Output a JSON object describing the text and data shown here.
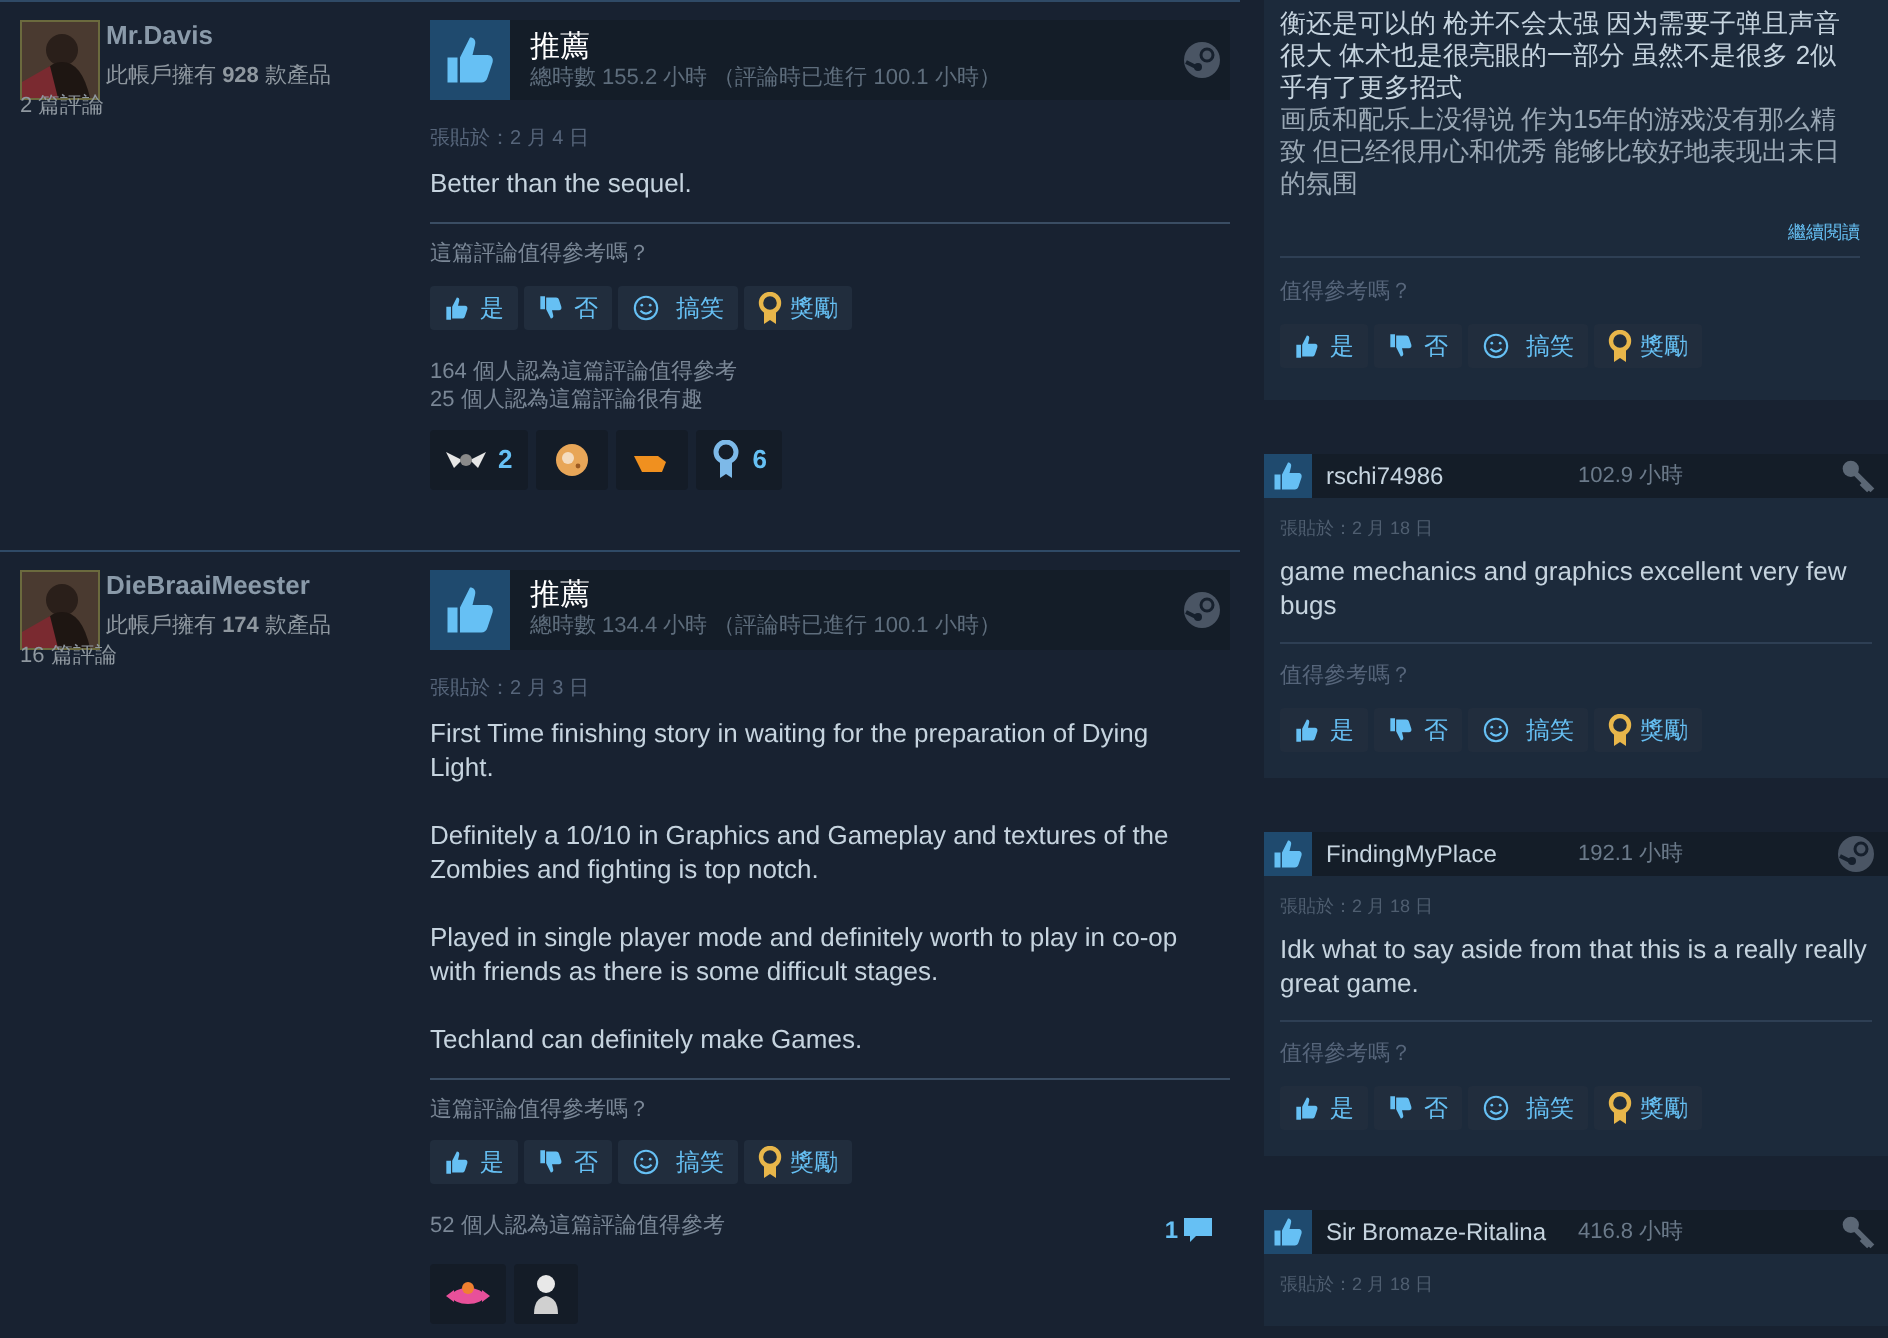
{
  "main_reviews": [
    {
      "author": {
        "name": "Mr.Davis",
        "products": "此帳戶擁有 **928** 款產品",
        "reviews": "2 篇評論"
      },
      "verdict": "推薦",
      "hours": "總時數 155.2 小時 （評論時已進行 100.1 小時）",
      "source": {
        "kind": "steam"
      },
      "posted": "張貼於：2 月 4 日",
      "body": "Better than the sequel.",
      "question": "這篇評論值得參考嗎？",
      "votes": [
        {
          "label": "是",
          "kind": "yes"
        },
        {
          "label": "否",
          "kind": "no"
        },
        {
          "label": "搞笑",
          "kind": "funny"
        },
        {
          "label": "獎勵",
          "kind": "award"
        }
      ],
      "stats": [
        "164 個人認為這篇評論值得參考",
        "25 個人認為這篇評論很有趣"
      ],
      "awards": [
        {
          "kind": "wings",
          "count": "2"
        },
        {
          "kind": "cookie"
        },
        {
          "kind": "hand"
        },
        {
          "kind": "medal",
          "count": "6"
        }
      ]
    },
    {
      "author": {
        "name": "DieBraaiMeester",
        "products": "此帳戶擁有 **174** 款產品",
        "reviews": "16 篇評論"
      },
      "verdict": "推薦",
      "hours": "總時數 134.4 小時 （評論時已進行 100.1 小時）",
      "source": {
        "kind": "steam"
      },
      "posted": "張貼於：2 月 3 日",
      "body": "First Time finishing story in waiting for the preparation of Dying Light.\n\nDefinitely a 10/10 in Graphics and Gameplay and textures of the Zombies and fighting is top notch.\n\nPlayed in single player mode and definitely worth to play in co-op with friends as there is some difficult stages.\n\nTechland can definitely make Games.",
      "question": "這篇評論值得參考嗎？",
      "votes": [
        {
          "label": "是",
          "kind": "yes"
        },
        {
          "label": "否",
          "kind": "no"
        },
        {
          "label": "搞笑",
          "kind": "funny"
        },
        {
          "label": "獎勵",
          "kind": "award"
        }
      ],
      "stats": [
        "52 個人認為這篇評論值得參考"
      ],
      "comments": "1",
      "awards": [
        {
          "kind": "critter"
        },
        {
          "kind": "bust"
        }
      ]
    }
  ],
  "side_reviews": [
    {
      "kind": "excerpt",
      "paragraphs": [
        "衡还是可以的 枪并不会太强 因为需要子弹且声音很大 体术也是很亮眼的一部分 虽然不是很多 2似乎有了更多招式",
        "画质和配乐上没得说 作为15年的游戏没有那么精致 但已经很用心和优秀 能够比较好地表现出末日的氛围"
      ],
      "read_more": "繼續閱讀",
      "question": "值得參考嗎？",
      "votes": [
        {
          "label": "是",
          "kind": "yes"
        },
        {
          "label": "否",
          "kind": "no"
        },
        {
          "label": "搞笑",
          "kind": "funny"
        },
        {
          "label": "獎勵",
          "kind": "award"
        }
      ]
    },
    {
      "kind": "full",
      "name": "rschi74986",
      "hours": "102.9 小時",
      "source": {
        "kind": "key"
      },
      "posted": "張貼於：2 月 18 日",
      "body": "game mechanics and graphics excellent very few bugs",
      "question": "值得參考嗎？",
      "votes": [
        {
          "label": "是",
          "kind": "yes"
        },
        {
          "label": "否",
          "kind": "no"
        },
        {
          "label": "搞笑",
          "kind": "funny"
        },
        {
          "label": "獎勵",
          "kind": "award"
        }
      ]
    },
    {
      "kind": "full",
      "name": "FindingMyPlace",
      "hours": "192.1 小時",
      "source": {
        "kind": "steam"
      },
      "posted": "張貼於：2 月 18 日",
      "body": "Idk what to say aside from that this is a really really great game.",
      "question": "值得參考嗎？",
      "votes": [
        {
          "label": "是",
          "kind": "yes"
        },
        {
          "label": "否",
          "kind": "no"
        },
        {
          "label": "搞笑",
          "kind": "funny"
        },
        {
          "label": "獎勵",
          "kind": "award"
        }
      ]
    },
    {
      "kind": "full",
      "name": "Sir Bromaze-Ritalina",
      "hours": "416.8 小時",
      "source": {
        "kind": "key"
      },
      "posted": "張貼於：2 月 18 日"
    }
  ]
}
